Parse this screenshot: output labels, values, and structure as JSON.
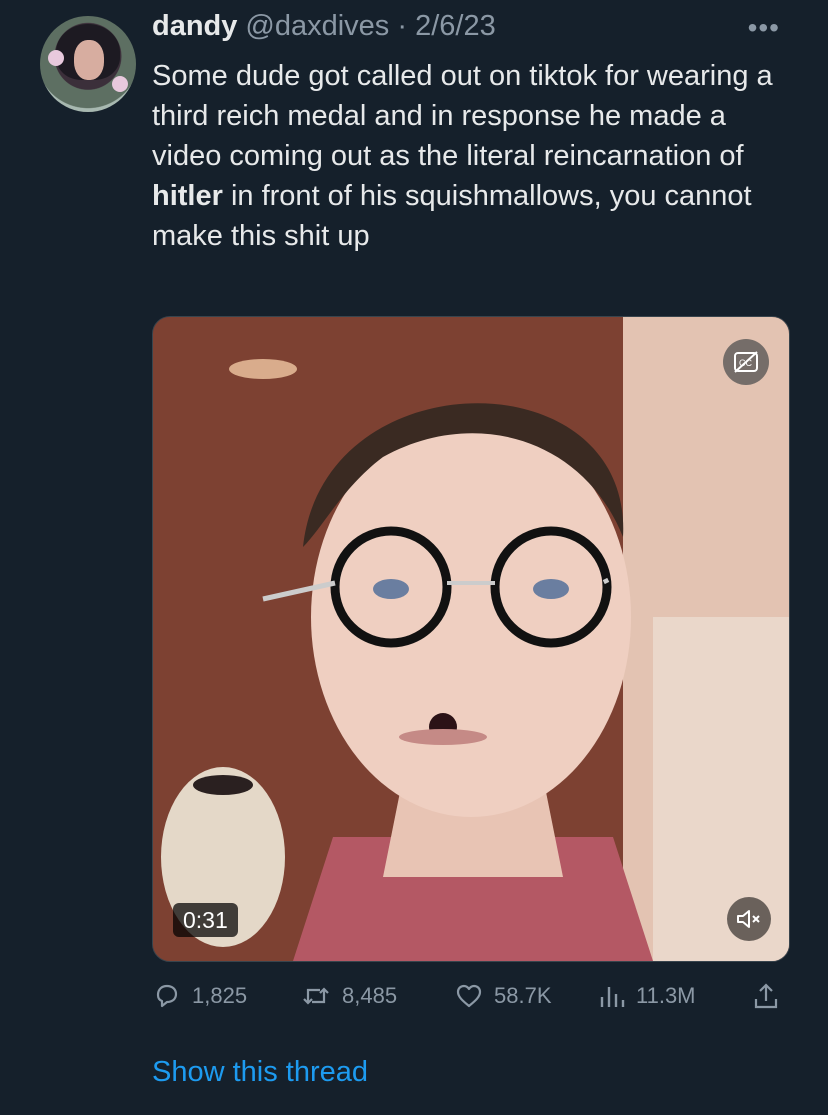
{
  "tweet": {
    "display_name": "dandy",
    "handle": "@daxdives",
    "separator": " · ",
    "date": "2/6/23",
    "text_before": "Some dude got called out on tiktok for wearing a third reich medal and in response he made a video coming out as the literal reincarnation of ",
    "text_bold": "hitler",
    "text_after": " in front of his squishmallows, you cannot make this shit up"
  },
  "media": {
    "duration": "0:31",
    "captions_icon": "captions-off-icon",
    "mute_icon": "speaker-muted-icon"
  },
  "actions": {
    "replies": "1,825",
    "retweets": "8,485",
    "likes": "58.7K",
    "views": "11.3M"
  },
  "thread_link": "Show this thread",
  "colors": {
    "background": "#15202b",
    "text_primary": "#e7e9ea",
    "text_secondary": "#8b98a5",
    "link": "#1d9bf0"
  }
}
